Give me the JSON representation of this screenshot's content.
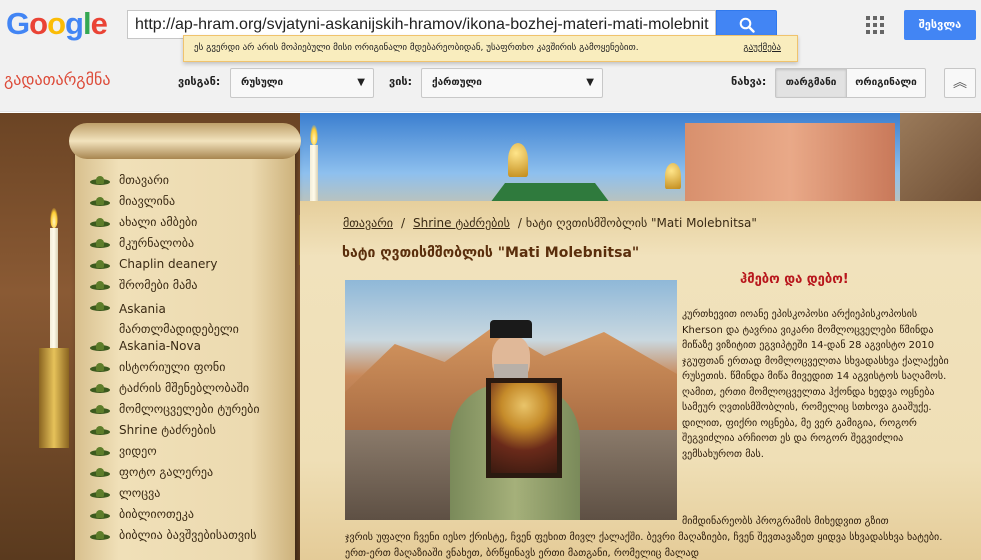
{
  "google": {
    "logo_letters": [
      "G",
      "o",
      "o",
      "g",
      "l",
      "e"
    ],
    "url": "http://ap-hram.org/svjatyni-askanijskih-hramov/ikona-bozhej-materi-mati-molebnit",
    "signin_label": "შესვლა",
    "notice_text": "ეს გვერდი არ არის მოპიებული მისი ორიგინალი მდებარეობიდან, უსაფრთხო კავშირის გამოყენებით.",
    "notice_link": "გაუქმება",
    "translate_label": "გადათარგმნა",
    "from_label": "ვისგან:",
    "from_value": "რუსული",
    "to_label": "ვის:",
    "to_value": "ქართული",
    "view_label": "ნახვა:",
    "view_translated": "თარგმანი",
    "view_original": "ორიგინალი",
    "colors": {
      "blue": "#4285f4",
      "red": "#dd4b39",
      "notice_bg": "#f9edbe"
    }
  },
  "sidebar": {
    "items": [
      {
        "label": "მთავარი"
      },
      {
        "label": "მიავლინა"
      },
      {
        "label": "ახალი ამბები"
      },
      {
        "label": "მკურნალობა"
      },
      {
        "label": "Chaplin deanery"
      },
      {
        "label": "შრომები მამა"
      },
      {
        "label": "Askania მართლმადიდებელი"
      },
      {
        "label": "Askania-Nova"
      },
      {
        "label": "ისტორიული ფონი"
      },
      {
        "label": "ტაძრის მშენებლობაში"
      },
      {
        "label": "მომლოცველები ტურები"
      },
      {
        "label": "Shrine ტაძრების"
      },
      {
        "label": "ვიდეო"
      },
      {
        "label": "ფოტო გალერეა"
      },
      {
        "label": "ლოცვა"
      },
      {
        "label": "ბიბლიოთეკა"
      },
      {
        "label": "ბიბლია ბავშვებისათვის"
      }
    ]
  },
  "content": {
    "breadcrumb": {
      "home": "მთავარი",
      "section": "Shrine ტაძრების",
      "current": "ხატი ღვთისმშობლის \"Mati Molebnitsa\""
    },
    "title": "ხატი ღვთისმშობლის \"Mati Molebnitsa\"",
    "pray_heading": "ჰმებო და დებო!",
    "article_p1": "კურთხევით იოანე ეპისკოპოსი არქიეპისკოპოსის Kherson და ტავრია ვიკარი მომლოცველები წმინდა მიწაზე ვიზიტით ეგვიპტეში 14-დან 28 აგვისტო 2010 ჯგუფთან ერთად მომლოცველთა სხვადასხვა ქალაქები რუსეთის. წმინდა მიწა მივედით 14 აგვისტოს საღამოს. ღამით, ერთი მომლოცველთა ჰქონდა ხედვა ოცნება სამეურ ღვთისმშობლის, რომელიც სთხოვა გააშუქე. დილით, ფიქრი ოცნება, მე ვერ გამიგია, როგორ შეგვიძლია არჩიოთ ეს და როგორ შეგვიძლია ვემსახუროთ მას.",
    "article_p2": "მიმდინარეობს პროგრამის მიხედვით გზით",
    "article_p3": "ჯვრის უფალი ჩვენი იესო ქრისტე, ჩვენ ფეხით მივლ ქალაქში. ბევრი მაღაზიები, ჩვენ შევთავაზეთ ყიდვა სხვადასხვა ხატები. ერთ-ერთ მაღაზიაში ვნახეთ, ბრწყინავს ერთი მათგანი, რომელიც მალად"
  }
}
